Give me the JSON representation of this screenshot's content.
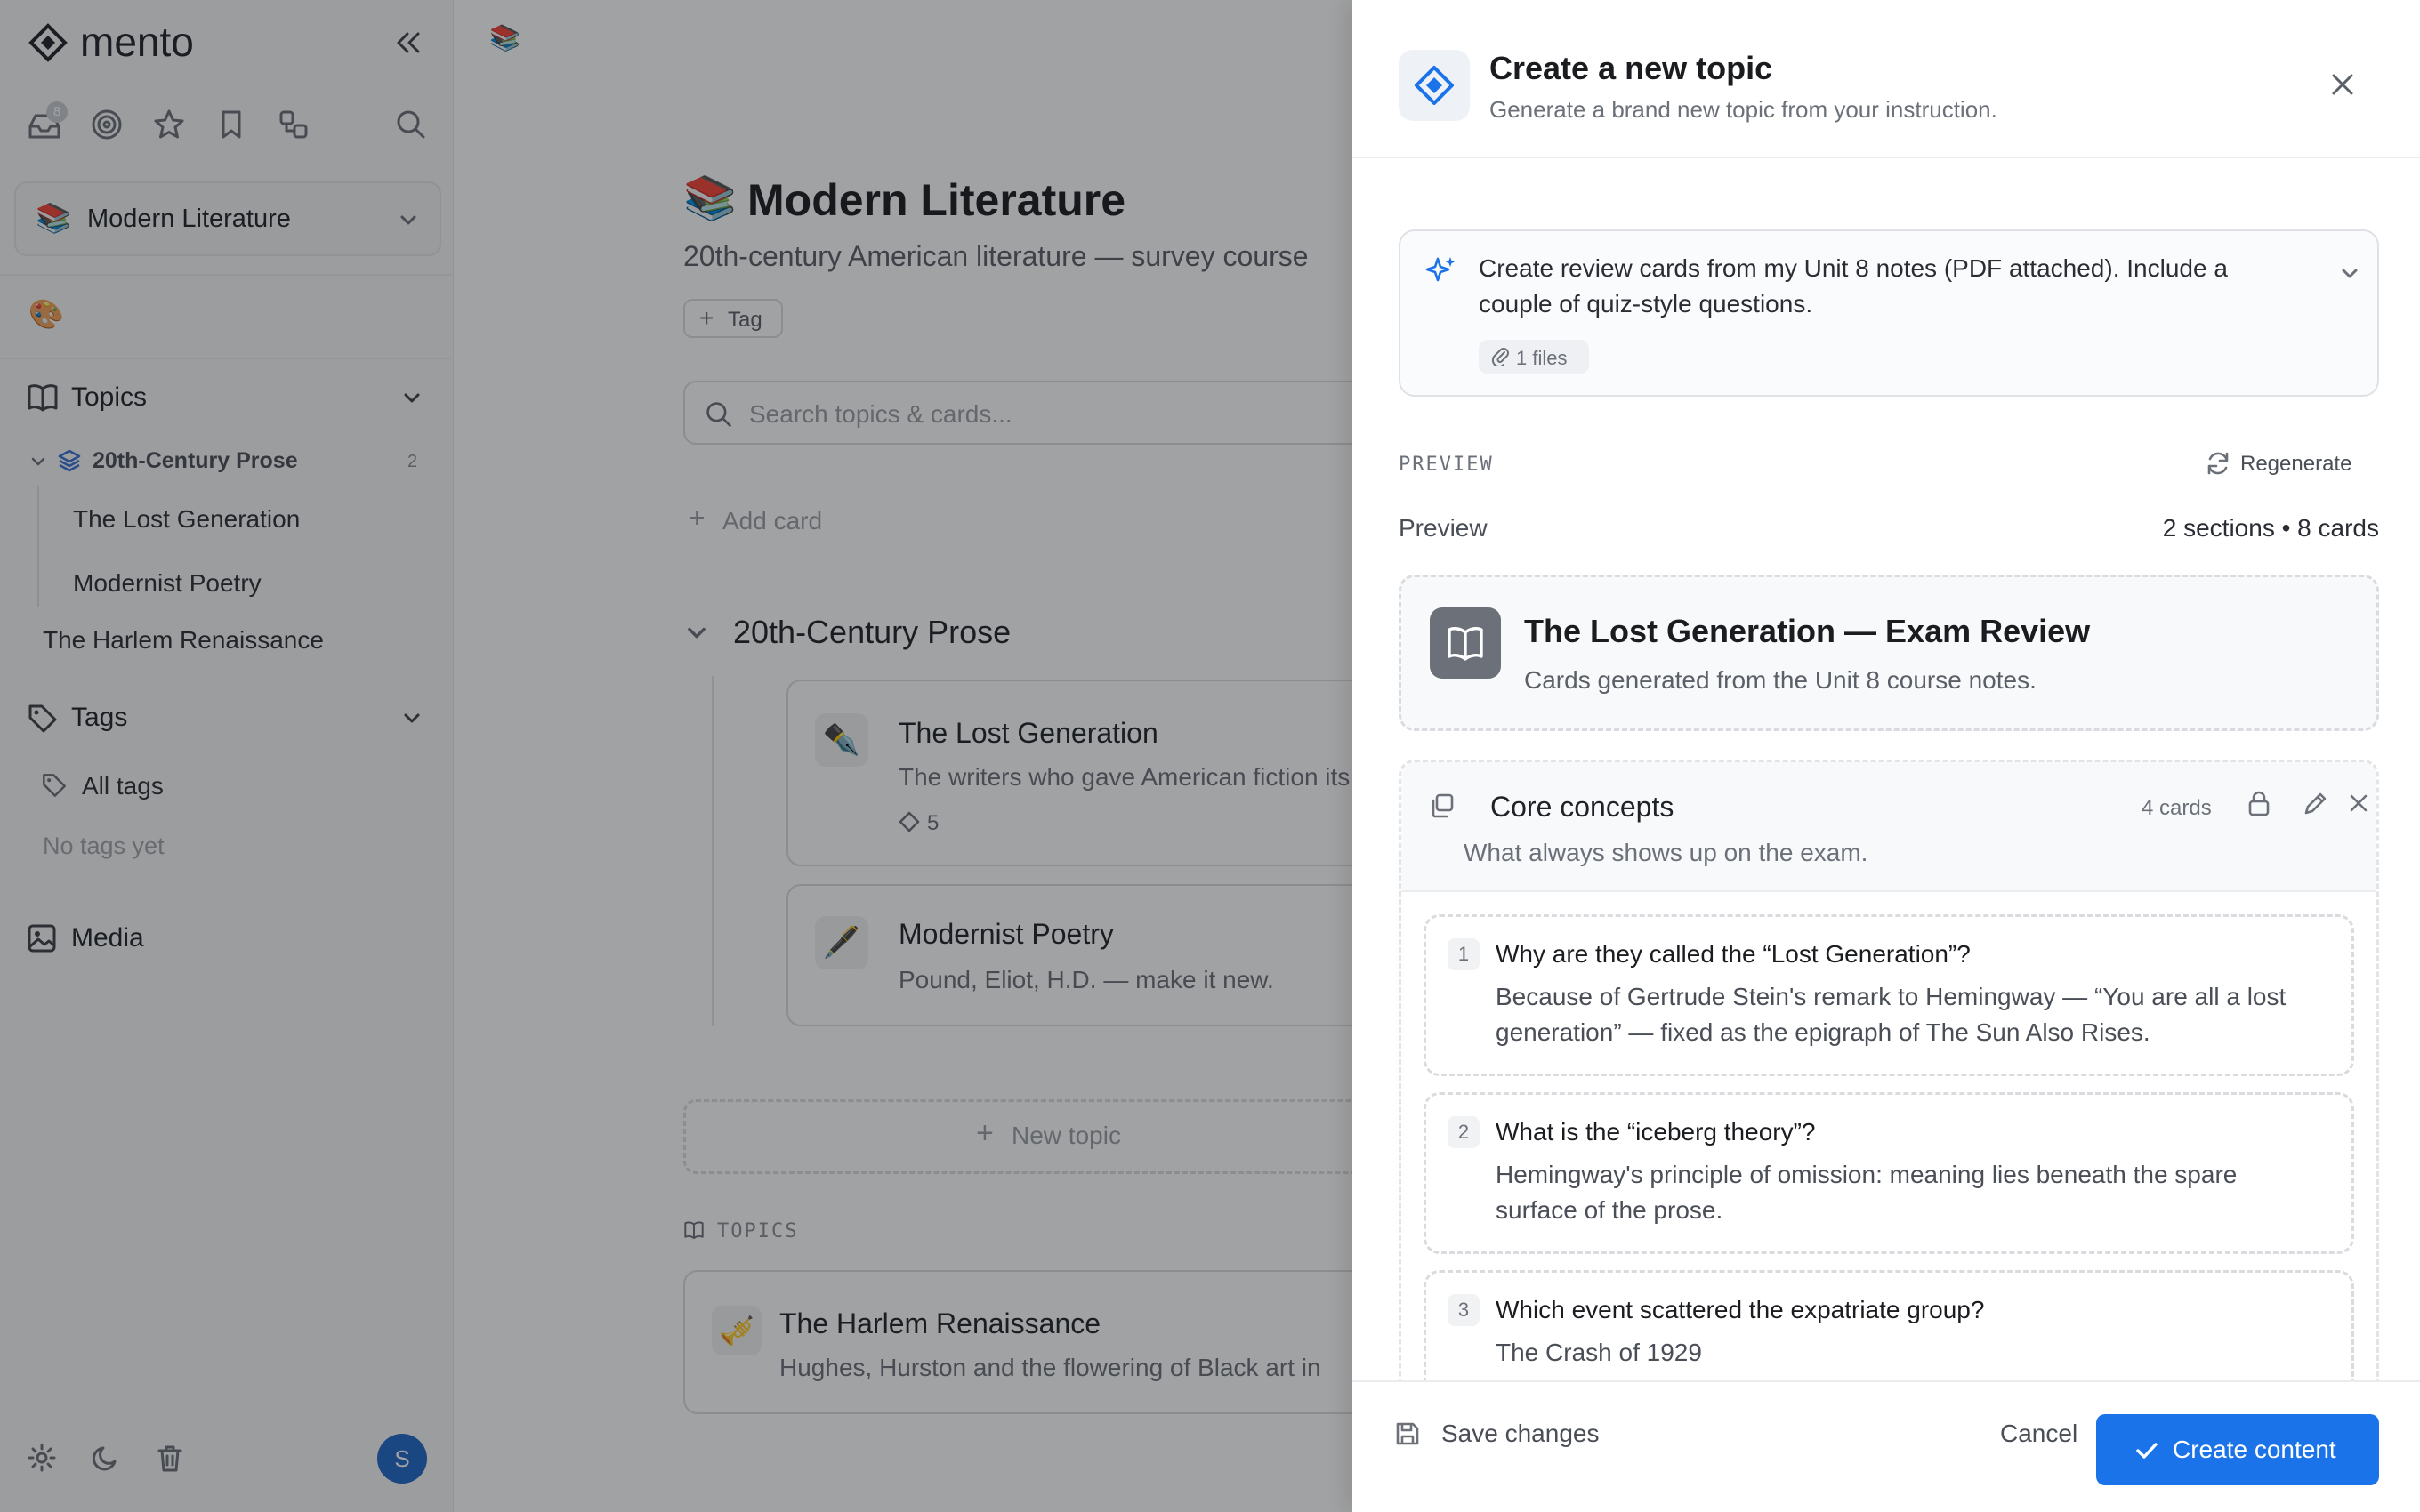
{
  "app": {
    "name": "mento",
    "inbox_badge": "8"
  },
  "sidebar": {
    "workspace": {
      "emoji": "📚",
      "name": "Modern Literature"
    },
    "palette_emoji": "🎨",
    "topics_label": "Topics",
    "topic_group": {
      "name": "20th-Century Prose",
      "count": "2",
      "children": [
        "The Lost Generation",
        "Modernist Poetry"
      ]
    },
    "topic_standalone": "The Harlem Renaissance",
    "tags_label": "Tags",
    "all_tags": "All tags",
    "no_tags": "No tags yet",
    "media_label": "Media",
    "avatar_initial": "S"
  },
  "main": {
    "breadcrumb_emoji": "📚",
    "title_emoji": "📚",
    "title": "Modern Literature",
    "subtitle": "20th-century American literature — survey course",
    "tag_button": "Tag",
    "search_placeholder": "Search topics & cards...",
    "add_card": "Add card",
    "section_title": "20th-Century Prose",
    "cards": [
      {
        "emoji": "✒️",
        "title": "The Lost Generation",
        "desc": "The writers who gave American fiction its",
        "count": "5"
      },
      {
        "emoji": "🖋️",
        "title": "Modernist Poetry",
        "desc": "Pound, Eliot, H.D. — make it new."
      }
    ],
    "new_topic": "New topic",
    "topics_heading": "TOPICS",
    "harlem": {
      "emoji": "🎺",
      "title": "The Harlem Renaissance",
      "desc": "Hughes, Hurston and the flowering of Black art in"
    }
  },
  "panel": {
    "title": "Create a new topic",
    "subtitle": "Generate a brand new topic from your instruction.",
    "instruction": "Create review cards from my Unit 8 notes (PDF attached). Include a couple of quiz-style questions.",
    "instruction_line1": "Create review cards from my Unit 8 notes (PDF attached). Include a",
    "instruction_line2": "couple of quiz-style questions.",
    "files_chip": "1 files",
    "preview_label": "PREVIEW",
    "regenerate": "Regenerate",
    "preview_heading": "Preview",
    "preview_stats": "2 sections • 8 cards",
    "topic_card": {
      "title": "The Lost Generation — Exam Review",
      "desc": "Cards generated from the Unit 8 course notes."
    },
    "section": {
      "title": "Core concepts",
      "desc": "What always shows up on the exam.",
      "count": "4 cards"
    },
    "qa": [
      {
        "n": "1",
        "q": "Why are they called the “Lost Generation”?",
        "a1": "Because of Gertrude Stein's remark to Hemingway — “You are all a lost",
        "a2": "generation” — fixed as the epigraph of The Sun Also Rises."
      },
      {
        "n": "2",
        "q": "What is the “iceberg theory”?",
        "a1": "Hemingway's principle of omission: meaning lies beneath the spare",
        "a2": "surface of the prose."
      },
      {
        "n": "3",
        "q": "Which event scattered the expatriate group?",
        "a1": "The Crash of 1929",
        "a2": ""
      }
    ],
    "save_changes": "Save changes",
    "cancel": "Cancel",
    "create": "Create content"
  },
  "colors": {
    "accent": "#1a73e8",
    "overlay": "rgba(20,22,26,0.40)",
    "sidebar_bg": "#f7f7f8"
  }
}
